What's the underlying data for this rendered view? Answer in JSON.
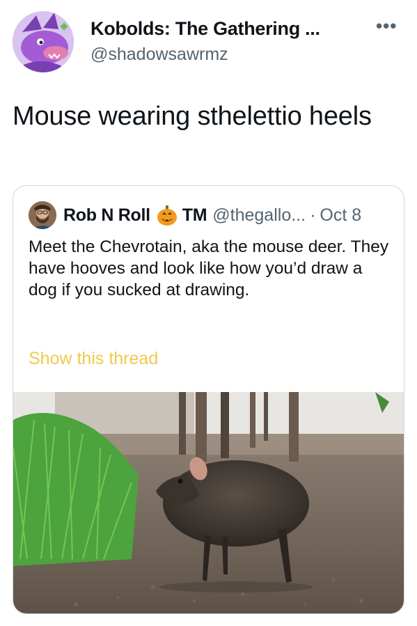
{
  "author": {
    "name": "Kobolds: The Gathering ...",
    "handle": "@shadowsawrmz"
  },
  "more_label": "•••",
  "tweet": {
    "text": "Mouse wearing sthelettio heels"
  },
  "quote": {
    "name": "Rob N Roll",
    "name_suffix": "TM",
    "handle": "@thegallo...",
    "separator": "·",
    "date": "Oct 8",
    "text": "Meet the Chevrotain, aka the mouse deer. They have hooves and look like how you’d draw a dog if you sucked at drawing.",
    "show_thread": "Show this thread"
  },
  "colors": {
    "secondary_text": "#536471",
    "show_thread": "#f2c94c",
    "border": "#cfd9de"
  }
}
